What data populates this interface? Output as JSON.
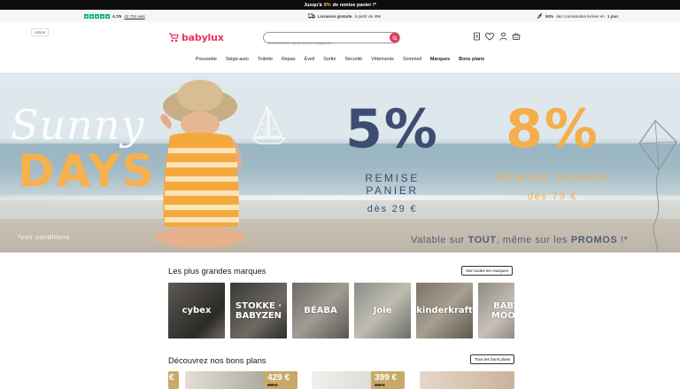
{
  "promo_bar": {
    "prefix": "Jusqu'à",
    "highlight": "8%",
    "suffix": "de remise panier !*"
  },
  "trust_bar": {
    "rating": "4,7/5",
    "reviews": "42 751 avis",
    "shipping_bold": "Livraison gratuite",
    "shipping_rest": "à partir de 49€",
    "dispatch_bold": "93%",
    "dispatch_mid": "des commandes livrées en",
    "dispatch_end": "1 jour"
  },
  "header": {
    "admin_badge": "Action",
    "logo_text": "babylux",
    "search_placeholder": "Rechercher dans tout le magasin...",
    "icons": [
      "cart-list-icon",
      "heart-icon",
      "user-icon",
      "basket-icon"
    ]
  },
  "nav": {
    "items": [
      {
        "label": "Poussette",
        "bold": false
      },
      {
        "label": "Siège-auto",
        "bold": false
      },
      {
        "label": "Toilette",
        "bold": false
      },
      {
        "label": "Repas",
        "bold": false
      },
      {
        "label": "Éveil",
        "bold": false
      },
      {
        "label": "Sortie",
        "bold": false
      },
      {
        "label": "Sécurité",
        "bold": false
      },
      {
        "label": "Vêtements",
        "bold": false
      },
      {
        "label": "Sommeil",
        "bold": false
      },
      {
        "label": "Marques",
        "bold": true
      },
      {
        "label": "Bons plans",
        "bold": true
      }
    ]
  },
  "hero": {
    "script_title": "Sunny",
    "big_title": "DAYS",
    "offer1": {
      "pct": "5%",
      "label": "REMISE PANIER",
      "sub": "dès 29 €"
    },
    "offer2": {
      "pct": "8%",
      "label": "REMISE PANIER",
      "sub": "dès 79 €"
    },
    "conditions": "*voir conditions",
    "valable_prefix": "Valable sur",
    "valable_bold1": "TOUT",
    "valable_mid": ", même sur les",
    "valable_bold2": "PROMOS",
    "valable_suffix": "!*"
  },
  "brands_section": {
    "title": "Les plus grandes marques",
    "button": "Voir toutes les marques",
    "brands": [
      {
        "name": "cybex"
      },
      {
        "name": "STOKKE · BABYZEN"
      },
      {
        "name": "BÉABA"
      },
      {
        "name": "Joie"
      },
      {
        "name": "kinderkraft"
      },
      {
        "name": "BABY MOOV"
      }
    ]
  },
  "deals_section": {
    "title": "Découvrez nos bons plans",
    "button": "Tous les bons plans",
    "deals": [
      {
        "price": "€",
        "old": ""
      },
      {
        "price": "429 €",
        "old": "399 €"
      },
      {
        "price": "399 €",
        "old": "449 €"
      }
    ]
  },
  "colors": {
    "brand_pink": "#e8355a",
    "offer_blue": "#3d4d72",
    "offer_orange": "#f5ae4c",
    "trustpilot_green": "#00b67a",
    "price_gold": "#c8a96a"
  }
}
